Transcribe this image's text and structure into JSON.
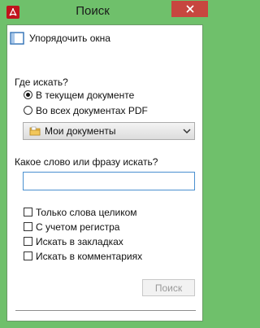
{
  "window": {
    "title": "Поиск"
  },
  "arrange_windows": {
    "label": "Упорядочить окна"
  },
  "where": {
    "heading": "Где искать?",
    "options": [
      {
        "label": "В текущем документе",
        "checked": true
      },
      {
        "label": "Во всех документах PDF",
        "checked": false
      }
    ],
    "folder": {
      "selected": "Мои документы"
    }
  },
  "query": {
    "label": "Какое слово или фразу искать?",
    "value": ""
  },
  "options": [
    {
      "label": "Только слова целиком",
      "checked": false
    },
    {
      "label": "С учетом регистра",
      "checked": false
    },
    {
      "label": "Искать в закладках",
      "checked": false
    },
    {
      "label": "Искать в комментариях",
      "checked": false
    }
  ],
  "search_button": {
    "label": "Поиск",
    "enabled": false
  },
  "colors": {
    "frame": "#6fc06b",
    "close": "#c7463f",
    "accent": "#4a90d0"
  }
}
